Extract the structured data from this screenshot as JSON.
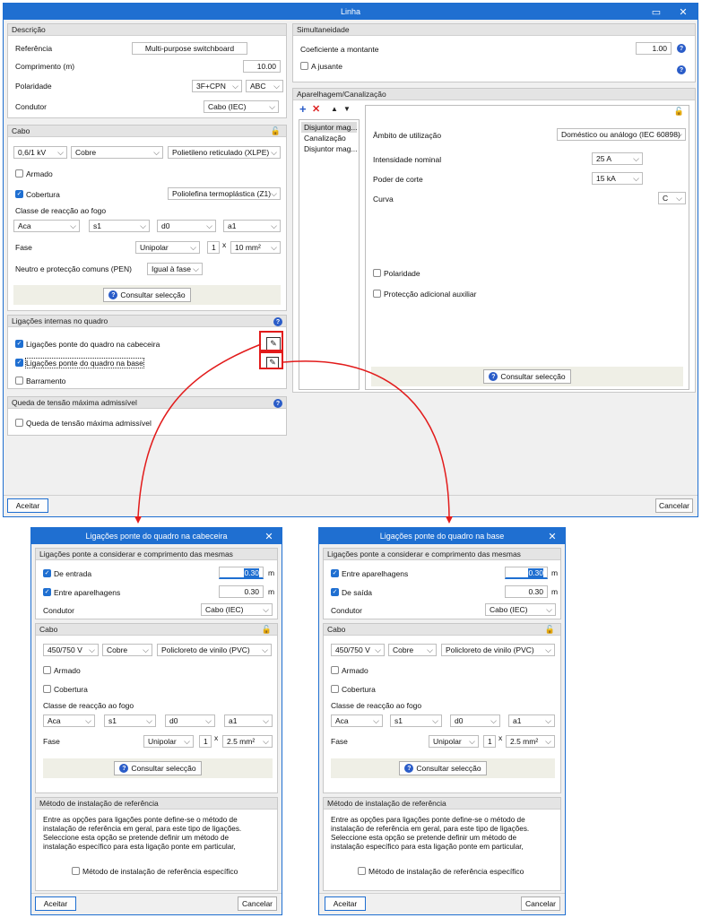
{
  "main": {
    "title": "Linha",
    "descricao": {
      "header": "Descrição",
      "ref_label": "Referência",
      "ref_value": "Multi-purpose switchboard",
      "comp_label": "Comprimento (m)",
      "comp_value": "10.00",
      "pol_label": "Polaridade",
      "pol_value": "3F+CPN",
      "pol_phase": "ABC",
      "cond_label": "Condutor",
      "cond_value": "Cabo (IEC)"
    },
    "cabo": {
      "header": "Cabo",
      "voltage": "0,6/1 kV",
      "material": "Cobre",
      "insulation": "Polietileno reticulado (XLPE)",
      "armado": "Armado",
      "cobertura": "Cobertura",
      "cobertura_value": "Poliolefina termoplástica (Z1)",
      "classe_label": "Classe de reacção ao fogo",
      "classe": [
        "Aca",
        "s1",
        "d0",
        "a1"
      ],
      "fase_label": "Fase",
      "fase_type": "Unipolar",
      "fase_count": "1",
      "fase_x": "x",
      "fase_section": "10 mm²",
      "neutro_label": "Neutro e protecção comuns (PEN)",
      "neutro_value": "Igual à fase",
      "consult": "Consultar selecção"
    },
    "ligacoes": {
      "header": "Ligações internas no quadro",
      "cabeceira": "Ligações ponte do quadro na cabeceira",
      "base": "Ligações ponte do quadro na base",
      "barramento": "Barramento"
    },
    "queda": {
      "header": "Queda de tensão máxima admissível",
      "label": "Queda de tensão máxima admissível"
    },
    "simult": {
      "header": "Simultaneidade",
      "coef_label": "Coeficiente a montante",
      "coef_value": "1.00",
      "jusante": "A jusante"
    },
    "aparelhagem": {
      "header": "Aparelhagem/Canalização",
      "items": [
        "Disjuntor mag...",
        "Canalização",
        "Disjuntor mag..."
      ],
      "ambito_label": "Âmbito de utilização",
      "ambito_value": "Doméstico ou análogo (IEC 60898)",
      "int_label": "Intensidade nominal",
      "int_value": "25 A",
      "poder_label": "Poder de corte",
      "poder_value": "15 kA",
      "curva_label": "Curva",
      "curva_value": "C",
      "polaridade": "Polaridade",
      "proteccao": "Protecção adicional auxiliar",
      "consult": "Consultar selecção"
    },
    "aceitar": "Aceitar",
    "cancelar": "Cancelar"
  },
  "cab": {
    "title": "Ligações ponte do quadro na cabeceira",
    "header": "Ligações ponte a considerar e comprimento das mesmas",
    "r1_label": "De entrada",
    "r1_value": "0.30",
    "r2_label": "Entre aparelhagens",
    "r2_value": "0.30",
    "unit": "m",
    "cond_label": "Condutor",
    "cond_value": "Cabo (IEC)",
    "cabo_header": "Cabo",
    "voltage": "450/750 V",
    "material": "Cobre",
    "insulation": "Policloreto de vinilo (PVC)",
    "armado": "Armado",
    "cobertura": "Cobertura",
    "classe_label": "Classe de reacção ao fogo",
    "classe": [
      "Aca",
      "s1",
      "d0",
      "a1"
    ],
    "fase_label": "Fase",
    "fase_type": "Unipolar",
    "fase_count": "1",
    "fase_x": "x",
    "fase_section": "2.5 mm²",
    "consult": "Consultar selecção",
    "metodo_header": "Método de instalação de referência",
    "metodo_text": "Entre as opções para ligações ponte define-se o método de instalação de referência em geral, para este tipo de ligações. Seleccione esta opção se pretende definir um método de instalação específico para esta ligação ponte em particular,",
    "metodo_cb": "Método de instalação de referência específico",
    "aceitar": "Aceitar",
    "cancelar": "Cancelar"
  },
  "base": {
    "title": "Ligações ponte do quadro na base",
    "header": "Ligações ponte a considerar e comprimento das mesmas",
    "r1_label": "Entre aparelhagens",
    "r1_value": "0.30",
    "r2_label": "De saída",
    "r2_value": "0.30",
    "unit": "m",
    "cond_label": "Condutor",
    "cond_value": "Cabo (IEC)",
    "cabo_header": "Cabo",
    "voltage": "450/750 V",
    "material": "Cobre",
    "insulation": "Policloreto de vinilo (PVC)",
    "armado": "Armado",
    "cobertura": "Cobertura",
    "classe_label": "Classe de reacção ao fogo",
    "classe": [
      "Aca",
      "s1",
      "d0",
      "a1"
    ],
    "fase_label": "Fase",
    "fase_type": "Unipolar",
    "fase_count": "1",
    "fase_x": "x",
    "fase_section": "2.5 mm²",
    "consult": "Consultar selecção",
    "metodo_header": "Método de instalação de referência",
    "metodo_text": "Entre as opções para ligações ponte define-se o método de instalação de referência em geral, para este tipo de ligações. Seleccione esta opção se pretende definir um método de instalação específico para esta ligação ponte em particular,",
    "metodo_cb": "Método de instalação de referência específico",
    "aceitar": "Aceitar",
    "cancelar": "Cancelar"
  }
}
